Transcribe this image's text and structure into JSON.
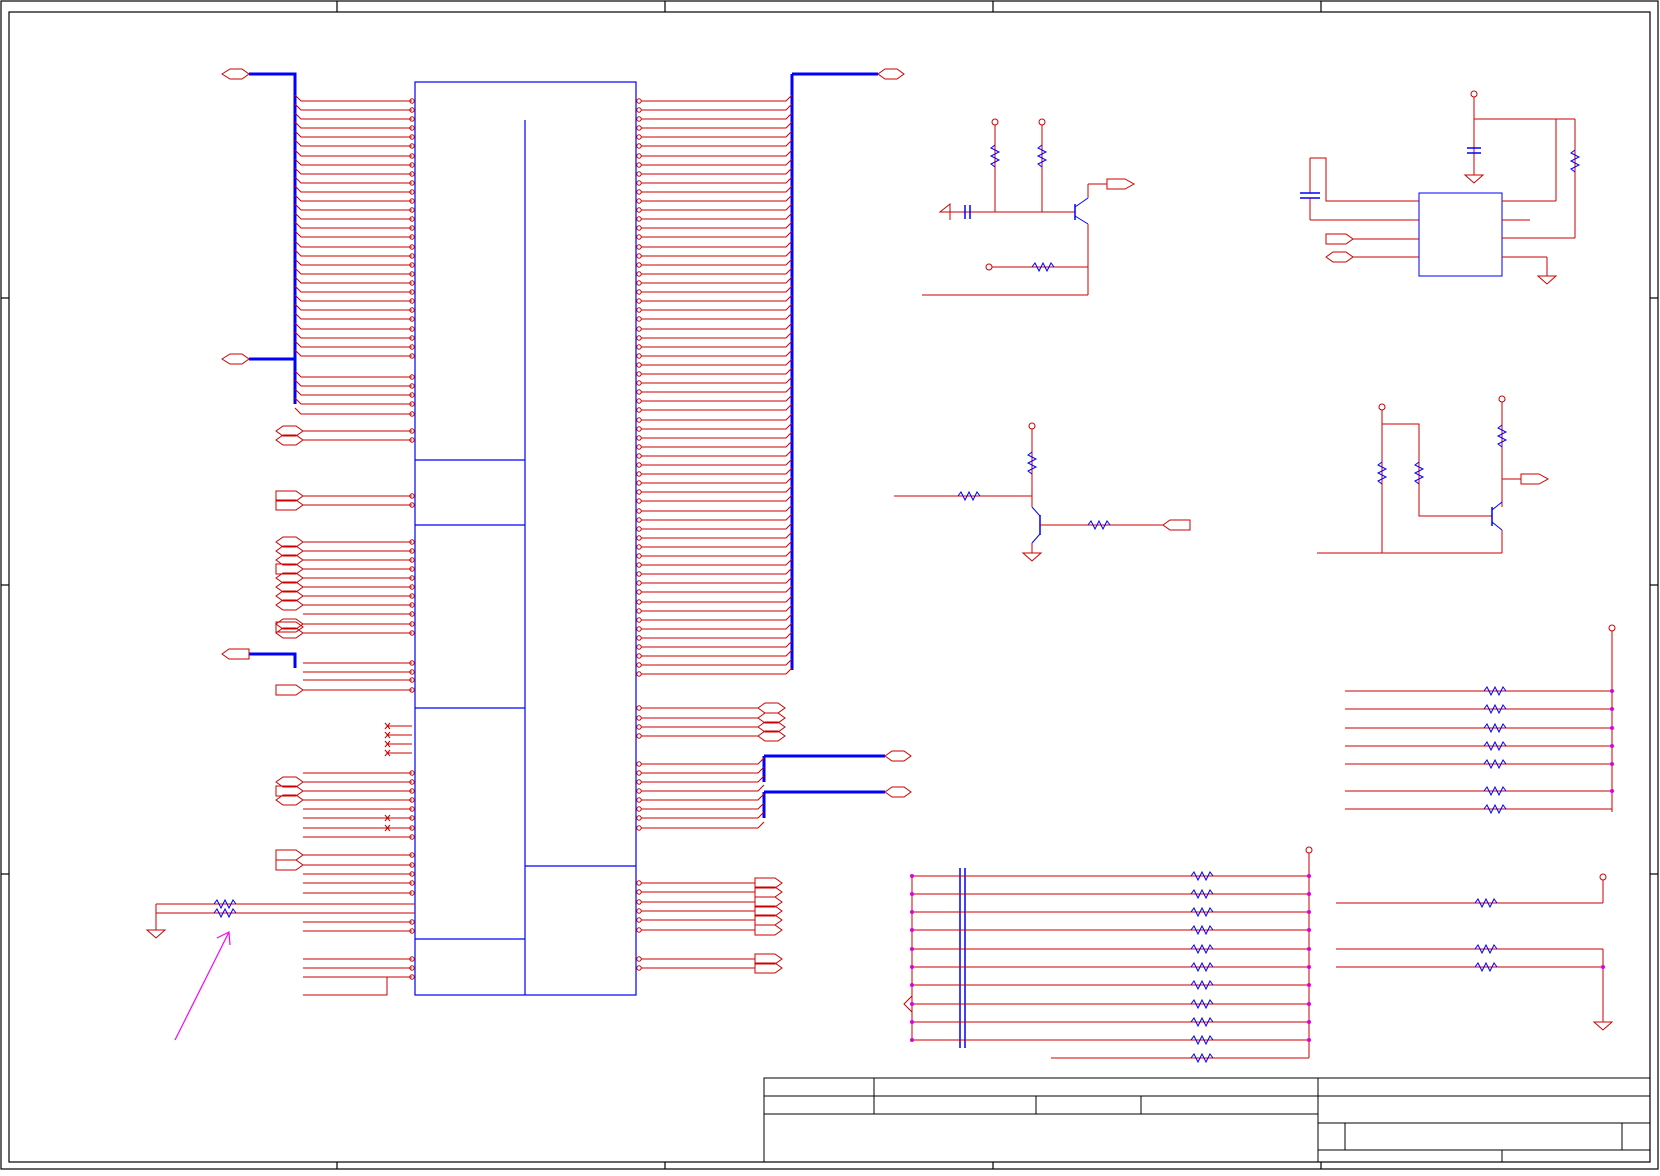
{
  "sheet": {
    "wire_color": "#cc0000",
    "bus_color": "#0000ff",
    "part_color": "#0000ff",
    "junction_color": "#dd00dd",
    "frame_color": "#000000",
    "annotation_color": "#ff00ff"
  },
  "title_block": {
    "rows": 3,
    "texts": []
  }
}
